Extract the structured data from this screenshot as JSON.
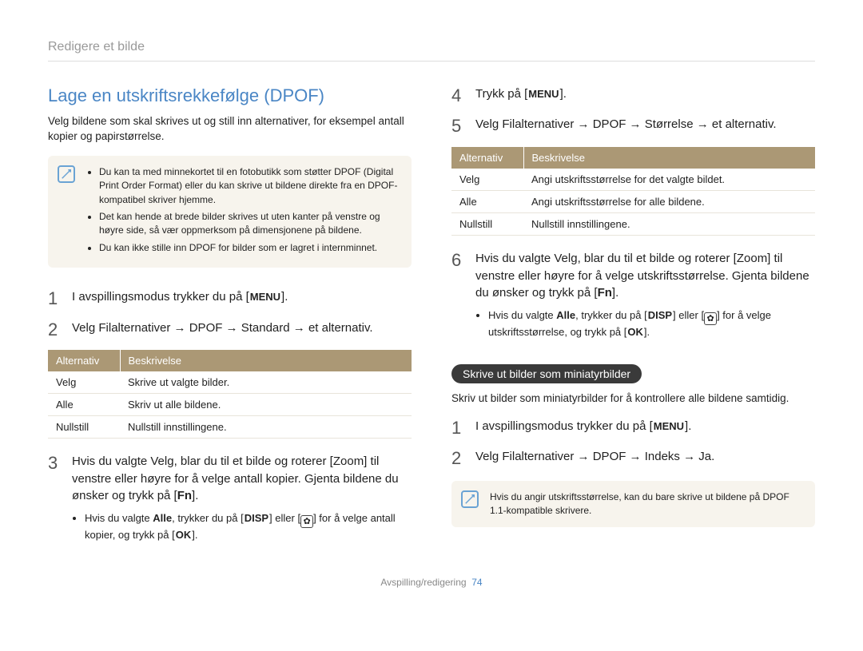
{
  "breadcrumb": "Redigere et bilde",
  "heading": "Lage en utskriftsrekkefølge (DPOF)",
  "intro": "Velg bildene som skal skrives ut og still inn alternativer, for eksempel antall kopier og papirstørrelse.",
  "note1": {
    "items": [
      "Du kan ta med minnekortet til en fotobutikk som støtter DPOF (Digital Print Order Format) eller du kan skrive ut bildene direkte fra en DPOF-kompatibel skriver hjemme.",
      "Det kan hende at brede bilder skrives ut uten kanter på venstre og høyre side, så vær oppmerksom på dimensjonene på bildene.",
      "Du kan ikke stille inn DPOF for bilder som er lagret i internminnet."
    ]
  },
  "labels": {
    "menu": "MENU",
    "disp": "DISP",
    "ok": "OK",
    "fn": "Fn"
  },
  "left": {
    "step1": "I avspillingsmodus trykker du på [",
    "step1_end": "].",
    "step2": "Velg Filalternativer → DPOF → Standard → et alternativ.",
    "table1": {
      "h1": "Alternativ",
      "h2": "Beskrivelse",
      "rows": [
        {
          "a": "Velg",
          "b": "Skrive ut valgte bilder."
        },
        {
          "a": "Alle",
          "b": "Skriv ut alle bildene."
        },
        {
          "a": "Nullstill",
          "b": "Nullstill innstillingene."
        }
      ]
    },
    "step3_a": "Hvis du valgte Velg, blar du til et bilde og roterer [Zoom] til venstre eller høyre for å velge antall kopier. Gjenta bildene du ønsker og trykk på [",
    "step3_b": "].",
    "step3_sub_a": "Hvis du valgte ",
    "step3_sub_alle": "Alle",
    "step3_sub_b": ", trykker du på [",
    "step3_sub_c": "] eller [",
    "step3_sub_d": "] for å velge antall kopier, og trykk på [",
    "step3_sub_e": "]."
  },
  "right": {
    "step4": "Trykk på [",
    "step4_end": "].",
    "step5": "Velg Filalternativer → DPOF → Størrelse → et alternativ.",
    "table2": {
      "h1": "Alternativ",
      "h2": "Beskrivelse",
      "rows": [
        {
          "a": "Velg",
          "b": "Angi utskriftsstørrelse for det valgte bildet."
        },
        {
          "a": "Alle",
          "b": "Angi utskriftsstørrelse for alle bildene."
        },
        {
          "a": "Nullstill",
          "b": "Nullstill innstillingene."
        }
      ]
    },
    "step6_a": "Hvis du valgte Velg, blar du til et bilde og roterer [Zoom] til venstre eller høyre for å velge utskriftsstørrelse. Gjenta bildene du ønsker og trykk på [",
    "step6_b": "].",
    "step6_sub_a": "Hvis du valgte ",
    "step6_sub_alle": "Alle",
    "step6_sub_b": ", trykker du på [",
    "step6_sub_c": "] eller [",
    "step6_sub_d": "] for å velge utskriftsstørrelse, og trykk på [",
    "step6_sub_e": "].",
    "pill": "Skrive ut bilder som miniatyrbilder",
    "pill_desc": "Skriv ut bilder som miniatyrbilder for å kontrollere alle bildene samtidig.",
    "m_step1": "I avspillingsmodus trykker du på [",
    "m_step1_end": "].",
    "m_step2": "Velg Filalternativer → DPOF → Indeks → Ja.",
    "note2": "Hvis du angir utskriftsstørrelse, kan du bare skrive ut bildene på DPOF 1.1-kompatible skrivere."
  },
  "footer": {
    "section": "Avspilling/redigering",
    "page": "74"
  }
}
